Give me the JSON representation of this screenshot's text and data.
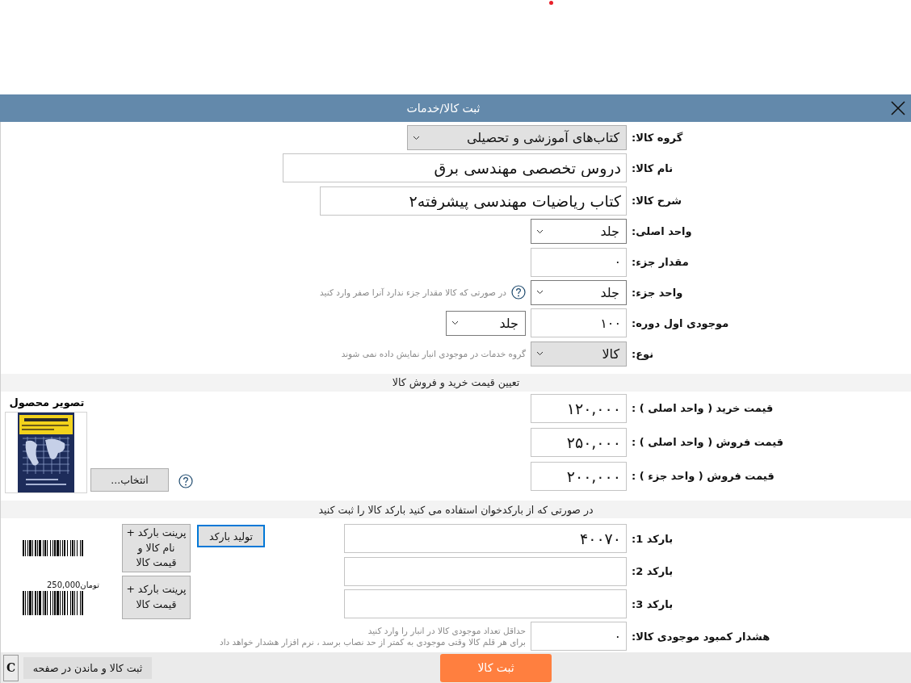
{
  "window": {
    "title": "ثبت کالا/خدمات"
  },
  "fields": [
    {
      "kind": "dropdown",
      "label": "گروه کالا:",
      "value": "کتاب‌های آموزشی و تحصیلی"
    },
    {
      "kind": "text",
      "label": "نام کالا:",
      "value": "دروس تخصصی مهندسی برق"
    },
    {
      "kind": "text",
      "label": "شرح کالا:",
      "value": "کتاب ریاضیات مهندسی پیشرفته۲"
    },
    {
      "kind": "combo",
      "label": "واحد اصلی:",
      "value": "جلد"
    },
    {
      "kind": "text",
      "label": "مقدار جزء:",
      "value": "۰"
    },
    {
      "kind": "combo",
      "label": "واحد جزء:",
      "value": "جلد",
      "help": true,
      "hint": "در صورتی که کالا مقدار جزء ندارد آنرا صفر وارد کنید"
    },
    {
      "kind": "text",
      "label": "موجودی اول دوره:",
      "value": "۱۰۰",
      "unit": "جلد"
    },
    {
      "kind": "dropdown",
      "label": "نوع:",
      "value": "کالا",
      "hint": "گروه خدمات در موجودی انبار نمایش داده نمی شوند"
    }
  ],
  "pricing": {
    "title": "تعیین قیمت خرید و فروش کالا",
    "fields": [
      {
        "label": "قیمت خرید ( واحد اصلی ) :",
        "value": "۱۲۰,۰۰۰"
      },
      {
        "label": "قیمت فروش ( واحد اصلی ) :",
        "value": "۲۵۰,۰۰۰"
      },
      {
        "label": "قیمت فروش ( واحد جزء ) :",
        "value": "۲۰۰,۰۰۰"
      }
    ],
    "image": {
      "title": "تصویر محصول",
      "button": "انتخاب...",
      "help": true
    }
  },
  "barcodes": {
    "title": "در صورتی که از بارکدخوان استفاده می کنید بارکد کالا را ثبت کنید",
    "fields": [
      {
        "label": "بارکد 1:",
        "value": "۴۰۰۷۰"
      },
      {
        "label": "بارکد 2:"
      },
      {
        "label": "بارکد 3:"
      }
    ],
    "generate_button": {
      "label": "تولید بارکد",
      "focused": true
    },
    "print_buttons": [
      {
        "label": "پرینت بارکد + نام کالا و قیمت کالا"
      },
      {
        "label": "پرینت بارکد + قیمت کالا",
        "preview_caption": "تومان250,000"
      }
    ]
  },
  "warning": {
    "label": "هشدار کمبود موجودی کالا:",
    "value": "۰",
    "hint_lines": [
      "حداقل تعداد موجودی کالا در انبار را وارد کنید",
      "برای هر قلم کالا وقتی موجودی به کمتر از حد نصاب برسد ، نرم افزار هشدار خواهد داد"
    ]
  },
  "footer": {
    "submit": "ثبت کالا",
    "stay": "ثبت کالا و ماندن در صفحه",
    "clear": "C"
  }
}
